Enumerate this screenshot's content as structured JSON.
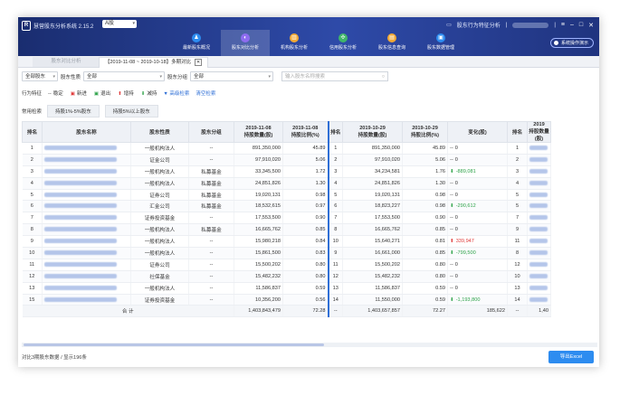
{
  "app": {
    "logo_letter": "R",
    "title": "慧营股东分析系统 2.15.2",
    "market": "A股",
    "topright_link": "股东行为特征分析",
    "window_buttons": [
      "≡",
      "–",
      "□",
      "✕"
    ],
    "guide_button": "系统操作演示"
  },
  "nav": [
    {
      "label": "最新股东概况",
      "icon": "users-icon",
      "color": "#2d8cf0",
      "glyph": "♟"
    },
    {
      "label": "股东对比分析",
      "icon": "compare-icon",
      "color": "#8e6cf0",
      "glyph": "◐"
    },
    {
      "label": "机构股东分析",
      "icon": "institution-icon",
      "color": "#f2a935",
      "glyph": "▥"
    },
    {
      "label": "信用股东分析",
      "icon": "credit-icon",
      "color": "#3fb56a",
      "glyph": "✣"
    },
    {
      "label": "股东信息查询",
      "icon": "info-icon",
      "color": "#f2a935",
      "glyph": "▤"
    },
    {
      "label": "股东数据管理",
      "icon": "data-icon",
      "color": "#2d8cf0",
      "glyph": "▣"
    }
  ],
  "active_nav": 1,
  "tabs": {
    "inactive": "股东对比分析",
    "active": "【2019-11-08 ~ 2019-10-18】多期对比"
  },
  "filters": {
    "shareholder_type": "全部股东",
    "nature_label": "股东性质",
    "nature_value": "全部",
    "group_label": "股东分组",
    "group_value": "全部",
    "search_placeholder": "输入股东名称搜索"
  },
  "legend": {
    "label": "行为特征",
    "items": [
      {
        "sym": "--",
        "text": "稳定",
        "color": "#333"
      },
      {
        "sym": "▣",
        "text": "新进",
        "color": "#e03b3b"
      },
      {
        "sym": "▣",
        "text": "退出",
        "color": "#2fa34a"
      },
      {
        "sym": "⬆",
        "text": "增持",
        "color": "#e03b3b"
      },
      {
        "sym": "⬇",
        "text": "减持",
        "color": "#2fa34a"
      }
    ],
    "advanced": "高级检索",
    "clear": "清空检索"
  },
  "quick": {
    "label": "常用检索",
    "buttons": [
      "持股1%-5%股东",
      "持股5%以上股东"
    ]
  },
  "table": {
    "headers": {
      "rank": "排名",
      "name": "股东名称",
      "nature": "股东性质",
      "group": "股东分组",
      "date1": "2019-11-08",
      "shares": "持股数量(股)",
      "ratio": "持股比例(%)",
      "date2": "2019-10-29",
      "change": "变化(股)",
      "date3": "2019"
    },
    "rows": [
      {
        "r1": "1",
        "nature": "一般机构法人",
        "group": "--",
        "s1": "891,350,000",
        "p1": "45.89",
        "r2": "1",
        "s2": "891,350,000",
        "p2": "45.89",
        "sym": "--",
        "cls": "",
        "chg": "0",
        "r3": "1",
        "w": 40
      },
      {
        "r1": "2",
        "nature": "证金公司",
        "group": "--",
        "s1": "97,910,020",
        "p1": "5.06",
        "r2": "2",
        "s2": "97,910,020",
        "p2": "5.06",
        "sym": "--",
        "cls": "",
        "chg": "0",
        "r3": "2",
        "w": 34
      },
      {
        "r1": "3",
        "nature": "一般机构法人",
        "group": "私募基金",
        "s1": "33,345,500",
        "p1": "1.72",
        "r2": "3",
        "s2": "34,234,581",
        "p2": "1.76",
        "sym": "⬇",
        "cls": "down",
        "chg": "-889,081",
        "r3": "3",
        "w": 46
      },
      {
        "r1": "4",
        "nature": "一般机构法人",
        "group": "私募基金",
        "s1": "24,851,826",
        "p1": "1.30",
        "r2": "4",
        "s2": "24,851,826",
        "p2": "1.30",
        "sym": "--",
        "cls": "",
        "chg": "0",
        "r3": "4",
        "w": 44
      },
      {
        "r1": "5",
        "nature": "证券公司",
        "group": "私募基金",
        "s1": "19,020,131",
        "p1": "0.98",
        "r2": "5",
        "s2": "19,020,131",
        "p2": "0.98",
        "sym": "--",
        "cls": "",
        "chg": "0",
        "r3": "5",
        "w": 38
      },
      {
        "r1": "6",
        "nature": "汇金公司",
        "group": "私募基金",
        "s1": "18,532,615",
        "p1": "0.97",
        "r2": "6",
        "s2": "18,823,227",
        "p2": "0.98",
        "sym": "⬇",
        "cls": "down",
        "chg": "-290,612",
        "r3": "5",
        "w": 42
      },
      {
        "r1": "7",
        "nature": "证券投资基金",
        "group": "--",
        "s1": "17,553,500",
        "p1": "0.90",
        "r2": "7",
        "s2": "17,553,500",
        "p2": "0.90",
        "sym": "--",
        "cls": "",
        "chg": "0",
        "r3": "7",
        "w": 46
      },
      {
        "r1": "8",
        "nature": "一般机构法人",
        "group": "私募基金",
        "s1": "16,665,762",
        "p1": "0.85",
        "r2": "8",
        "s2": "16,665,762",
        "p2": "0.85",
        "sym": "--",
        "cls": "",
        "chg": "0",
        "r3": "9",
        "w": 40
      },
      {
        "r1": "9",
        "nature": "一般机构法人",
        "group": "--",
        "s1": "15,980,218",
        "p1": "0.84",
        "r2": "10",
        "s2": "15,640,271",
        "p2": "0.81",
        "sym": "⬆",
        "cls": "up",
        "chg": "339,947",
        "r3": "11",
        "w": 44
      },
      {
        "r1": "10",
        "nature": "一般机构法人",
        "group": "--",
        "s1": "15,861,500",
        "p1": "0.83",
        "r2": "9",
        "s2": "16,661,000",
        "p2": "0.85",
        "sym": "⬇",
        "cls": "down",
        "chg": "-799,500",
        "r3": "8",
        "w": 46
      },
      {
        "r1": "11",
        "nature": "证券公司",
        "group": "--",
        "s1": "15,500,202",
        "p1": "0.80",
        "r2": "11",
        "s2": "15,500,202",
        "p2": "0.80",
        "sym": "--",
        "cls": "",
        "chg": "0",
        "r3": "12",
        "w": 34
      },
      {
        "r1": "12",
        "nature": "社保基金",
        "group": "--",
        "s1": "15,482,232",
        "p1": "0.80",
        "r2": "12",
        "s2": "15,482,232",
        "p2": "0.80",
        "sym": "--",
        "cls": "",
        "chg": "0",
        "r3": "10",
        "w": 38
      },
      {
        "r1": "13",
        "nature": "一般机构法人",
        "group": "--",
        "s1": "11,586,837",
        "p1": "0.59",
        "r2": "13",
        "s2": "11,586,837",
        "p2": "0.59",
        "sym": "--",
        "cls": "",
        "chg": "0",
        "r3": "13",
        "w": 44
      },
      {
        "r1": "15",
        "nature": "证券投资基金",
        "group": "--",
        "s1": "10,356,200",
        "p1": "0.56",
        "r2": "14",
        "s2": "11,550,000",
        "p2": "0.59",
        "sym": "⬇",
        "cls": "down",
        "chg": "-1,193,800",
        "r3": "14",
        "w": 46
      }
    ],
    "total": {
      "label": "合 计",
      "s1": "1,403,843,479",
      "p1": "72.28",
      "r2": "--",
      "s2": "1,403,657,857",
      "p2": "72.27",
      "chg": "185,622",
      "r3": "--",
      "tail": "1,40"
    }
  },
  "status": "对比3期股东数据 / 显示196条",
  "export_button": "导出Excel"
}
